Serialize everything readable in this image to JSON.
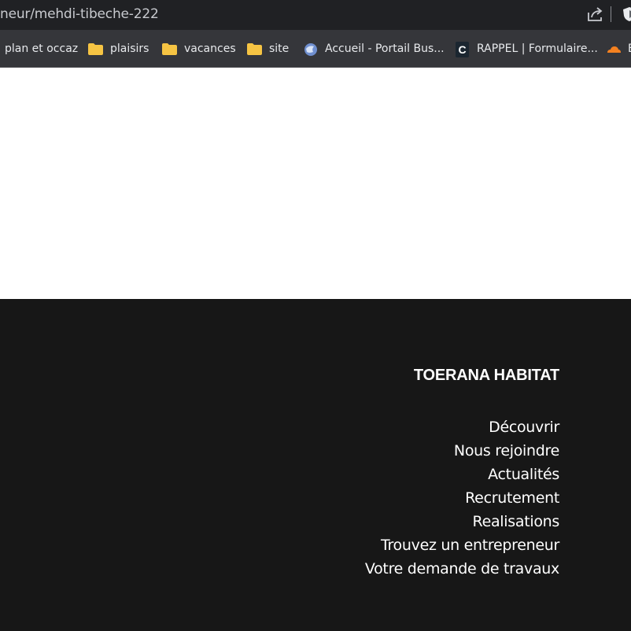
{
  "browser": {
    "url_text": "neur/mehdi-tibeche-222",
    "share_icon": "share-icon",
    "extension_icon": "shield-extension-icon"
  },
  "bookmarks": [
    {
      "label": "plan et occaz",
      "icon": "none"
    },
    {
      "label": "plaisirs",
      "icon": "folder-icon"
    },
    {
      "label": "vacances",
      "icon": "folder-icon"
    },
    {
      "label": "site",
      "icon": "folder-icon"
    },
    {
      "label": "Accueil - Portail Bus...",
      "icon": "globe-icon"
    },
    {
      "label": "RAPPEL | Formulaire...",
      "icon": "c-logo-icon"
    },
    {
      "label": "E",
      "icon": "cloud-icon"
    }
  ],
  "footer": {
    "brand": "TOERANA HABITAT",
    "links": [
      "Découvrir",
      "Nous rejoindre",
      "Actualités",
      "Recrutement",
      "Realisations",
      "Trouvez un entrepreneur",
      "Votre demande de travaux"
    ]
  },
  "colors": {
    "address_bar_bg": "#202124",
    "bookmarks_bg": "#35363a",
    "footer_bg": "#171717",
    "folder_yellow": "#f6c443"
  }
}
